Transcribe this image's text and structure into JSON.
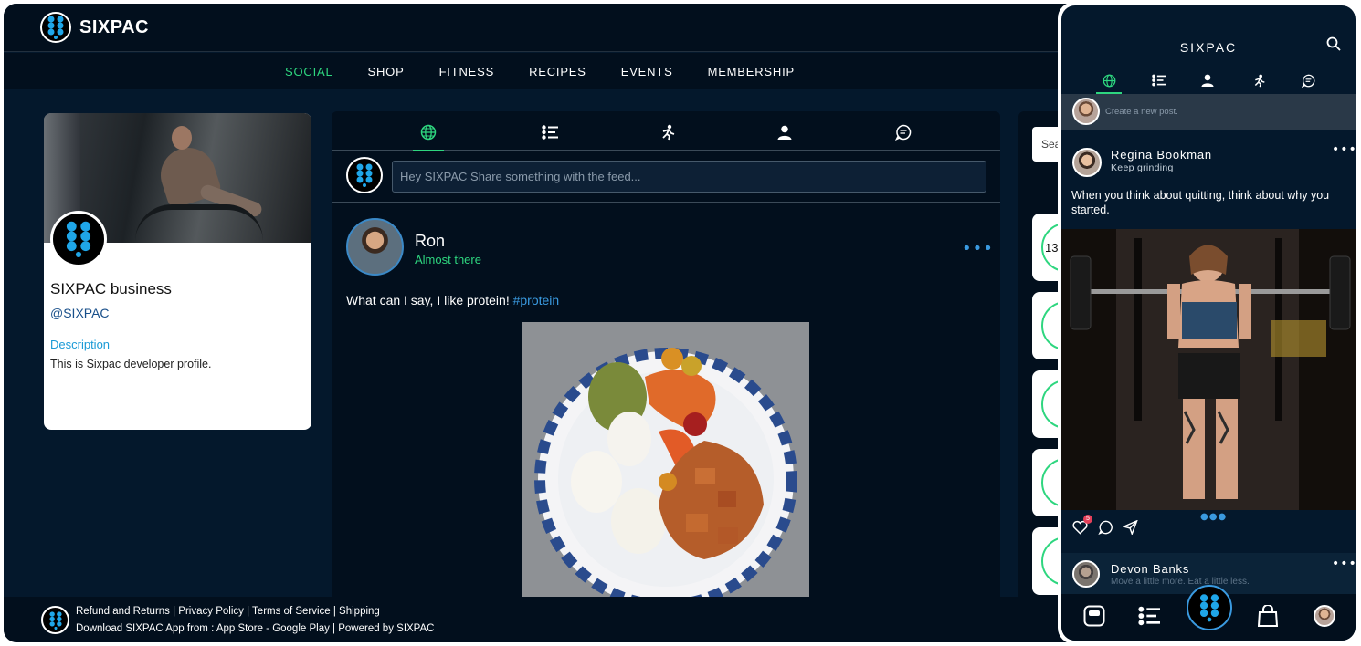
{
  "app": {
    "name": "SIXPAC"
  },
  "nav": {
    "items": [
      "SOCIAL",
      "SHOP",
      "FITNESS",
      "RECIPES",
      "EVENTS",
      "MEMBERSHIP"
    ],
    "active": "SOCIAL"
  },
  "profile": {
    "name": "SIXPAC business",
    "handle": "@SIXPAC",
    "description_label": "Description",
    "description": "This is Sixpac developer profile."
  },
  "feed": {
    "tabs": [
      "globe-icon",
      "list-icon",
      "workout-icon",
      "person-icon",
      "chat-icon"
    ],
    "active_tab": "globe-icon",
    "compose_placeholder": "Hey SIXPAC Share something with the feed...",
    "post": {
      "author": "Ron",
      "status": "Almost there",
      "text": "What can I say, I like protein!",
      "hashtag": "#protein",
      "more": "•••"
    }
  },
  "right": {
    "search_placeholder": "Sea",
    "stat_value": "13"
  },
  "footer": {
    "line1": "Refund and Returns | Privacy Policy | Terms of Service | Shipping",
    "line2": "Download SIXPAC App from : App Store - Google Play | Powered by SIXPAC"
  },
  "mobile": {
    "title": "SIXPAC",
    "compose_placeholder": "Create a new post.",
    "post": {
      "author": "Regina Bookman",
      "status": "Keep grinding",
      "text": "When you think about quitting, think about why you started.",
      "likes_badge": "5",
      "more": "•••"
    },
    "post2": {
      "author": "Devon Banks",
      "status": "Move a little more. Eat a little less.",
      "more": "•••"
    }
  },
  "colors": {
    "background": "#04182c",
    "panel": "#020f1d",
    "accent_green": "#2ed67f",
    "accent_blue": "#3a9ae0",
    "logo_blue": "#1fa6e8"
  }
}
